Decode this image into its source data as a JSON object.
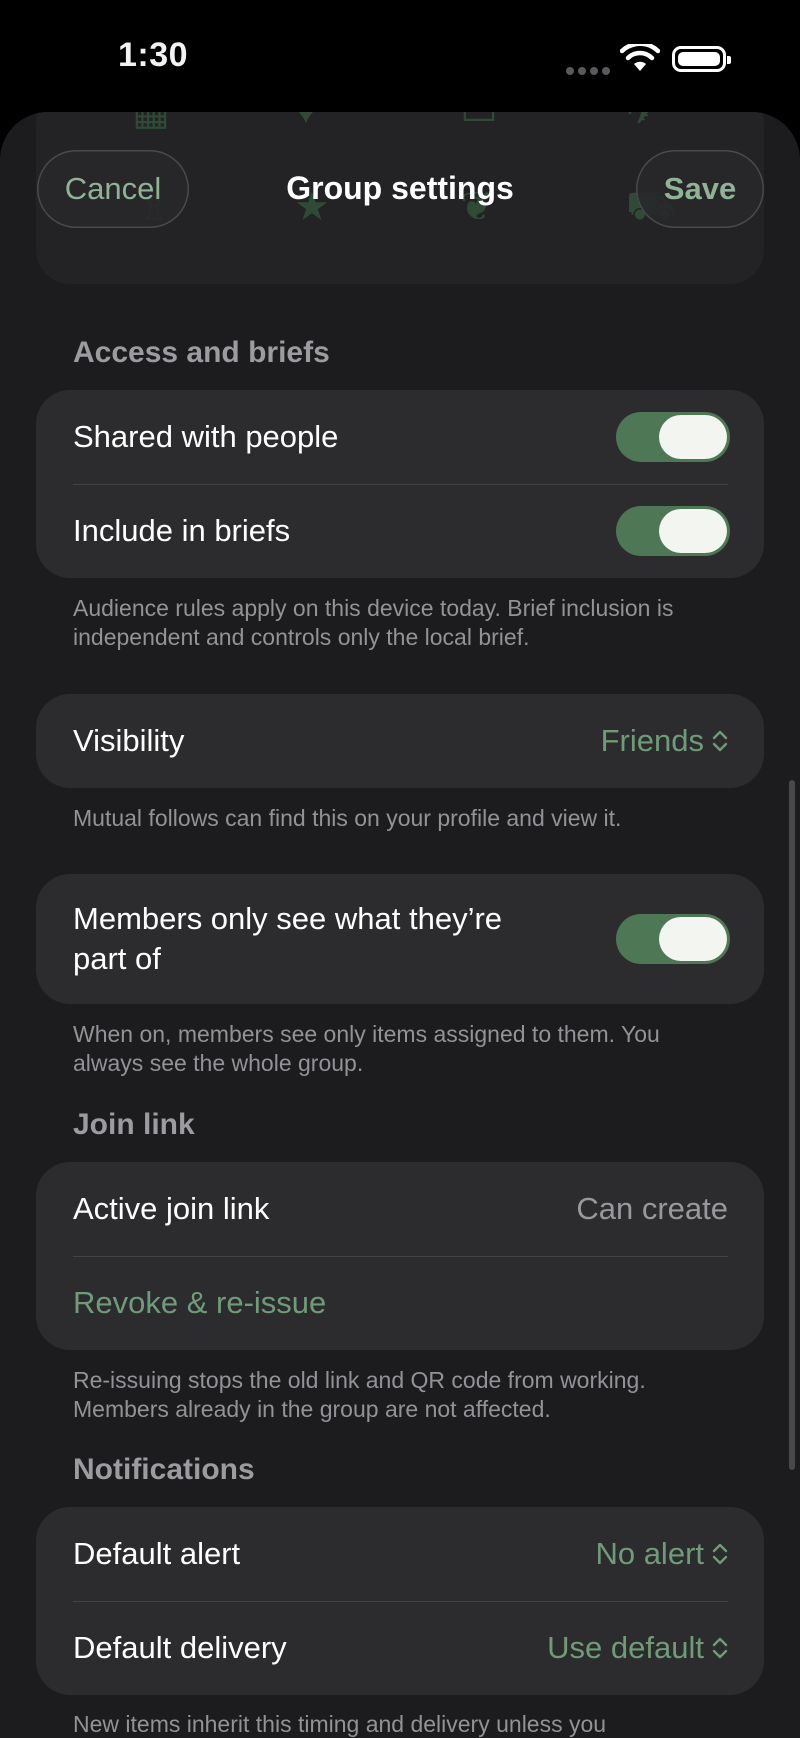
{
  "status_bar": {
    "time": "1:30",
    "icons": [
      "signal-icon",
      "wifi-icon",
      "battery-icon"
    ]
  },
  "nav": {
    "cancel": "Cancel",
    "title": "Group settings",
    "save": "Save"
  },
  "access": {
    "header": "Access and briefs",
    "shared_label": "Shared with people",
    "shared_on": true,
    "briefs_label": "Include in briefs",
    "briefs_on": true,
    "footnote": "Audience rules apply on this device today. Brief inclusion is independent and controls only the local brief."
  },
  "visibility": {
    "label": "Visibility",
    "value": "Friends",
    "footnote": "Mutual follows can find this on your profile and view it."
  },
  "members": {
    "label": "Members only see what they’re part of",
    "on": true,
    "footnote": "When on, members see only items assigned to them. You always see the whole group."
  },
  "join_link": {
    "header": "Join link",
    "active_label": "Active join link",
    "active_value": "Can create",
    "revoke_label": "Revoke & re-issue",
    "footnote": "Re-issuing stops the old link and QR code from working. Members already in the group are not affected."
  },
  "notifications": {
    "header": "Notifications",
    "alert_label": "Default alert",
    "alert_value": "No alert",
    "delivery_label": "Default delivery",
    "delivery_value": "Use default",
    "footnote": "New items inherit this timing and delivery unless you"
  },
  "colors": {
    "accent": "#6f9b78",
    "toggle_on": "#4e7756",
    "background": "#1c1c1e",
    "card": "#2c2c2e"
  }
}
